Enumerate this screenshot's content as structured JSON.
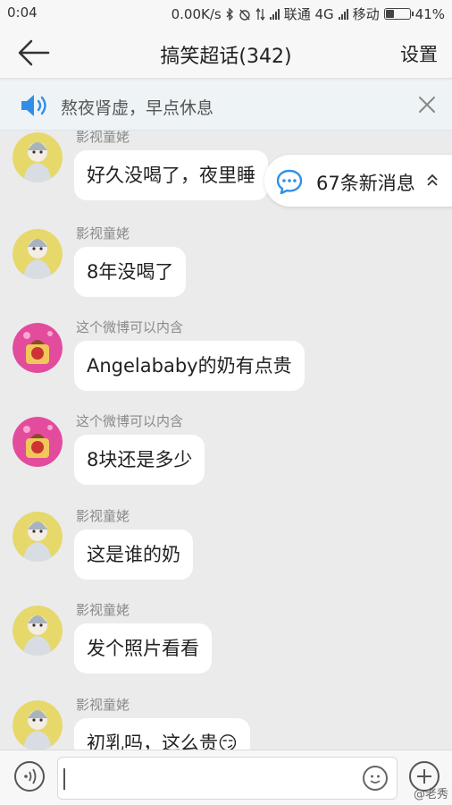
{
  "status_bar": {
    "time": "0:04",
    "speed": "0.00K/s",
    "carrier1": "联通 4G",
    "carrier2": "移动",
    "battery": "41%",
    "battery_level": 0.41
  },
  "header": {
    "title": "搞笑超话(342)",
    "settings_label": "设置"
  },
  "notice": {
    "text": "熬夜肾虚，早点休息"
  },
  "new_messages": {
    "label": "67条新消息"
  },
  "messages": [
    {
      "sender": "影视童姥",
      "text": "好久没喝了，夜里睡",
      "avatar": "grandma-avatar"
    },
    {
      "sender": "影视童姥",
      "text": "8年没喝了",
      "avatar": "grandma-avatar"
    },
    {
      "sender": "这个微博可以内含",
      "text": "Angelababy的奶有点贵",
      "avatar": "pink-avatar"
    },
    {
      "sender": "这个微博可以内含",
      "text": "8块还是多少",
      "avatar": "pink-avatar"
    },
    {
      "sender": "影视童姥",
      "text": "这是谁的奶",
      "avatar": "grandma-avatar"
    },
    {
      "sender": "影视童姥",
      "text": "发个照片看看",
      "avatar": "grandma-avatar"
    },
    {
      "sender": "影视童姥",
      "text": "初乳吗，这么贵😏",
      "avatar": "grandma-avatar"
    }
  ],
  "input": {
    "placeholder": ""
  },
  "watermark": "@老秀",
  "colors": {
    "accent_blue": "#2f8fe6",
    "bubble": "#ffffff",
    "background": "#ebebeb"
  }
}
